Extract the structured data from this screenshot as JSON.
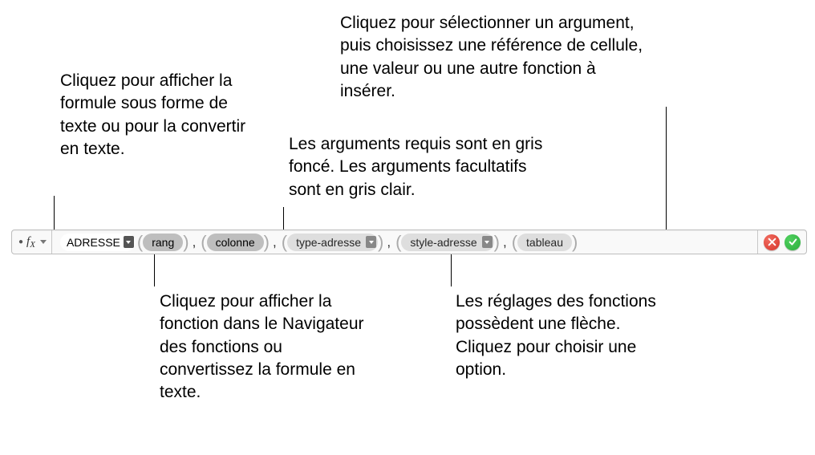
{
  "callouts": {
    "fx_menu": "Cliquez pour afficher la formule sous forme de texte ou pour la convertir en texte.",
    "arg_shading": "Les arguments requis sont en gris foncé. Les arguments facultatifs sont en gris clair.",
    "arg_select": "Cliquez pour sélectionner un argument, puis choisissez une référence de cellule, une valeur ou une autre fonction à insérer.",
    "func_browser": "Cliquez pour afficher la fonction dans le Navigateur des fonctions ou convertissez la formule en texte.",
    "arrow_settings": "Les réglages des fonctions possèdent une flèche. Cliquez pour choisir une option."
  },
  "formula_bar": {
    "fx_label": "f",
    "fx_sub": "X",
    "function_name": "ADRESSE",
    "args": {
      "rang": "rang",
      "colonne": "colonne",
      "type_adresse": "type-adresse",
      "style_adresse": "style-adresse",
      "tableau": "tableau"
    }
  }
}
